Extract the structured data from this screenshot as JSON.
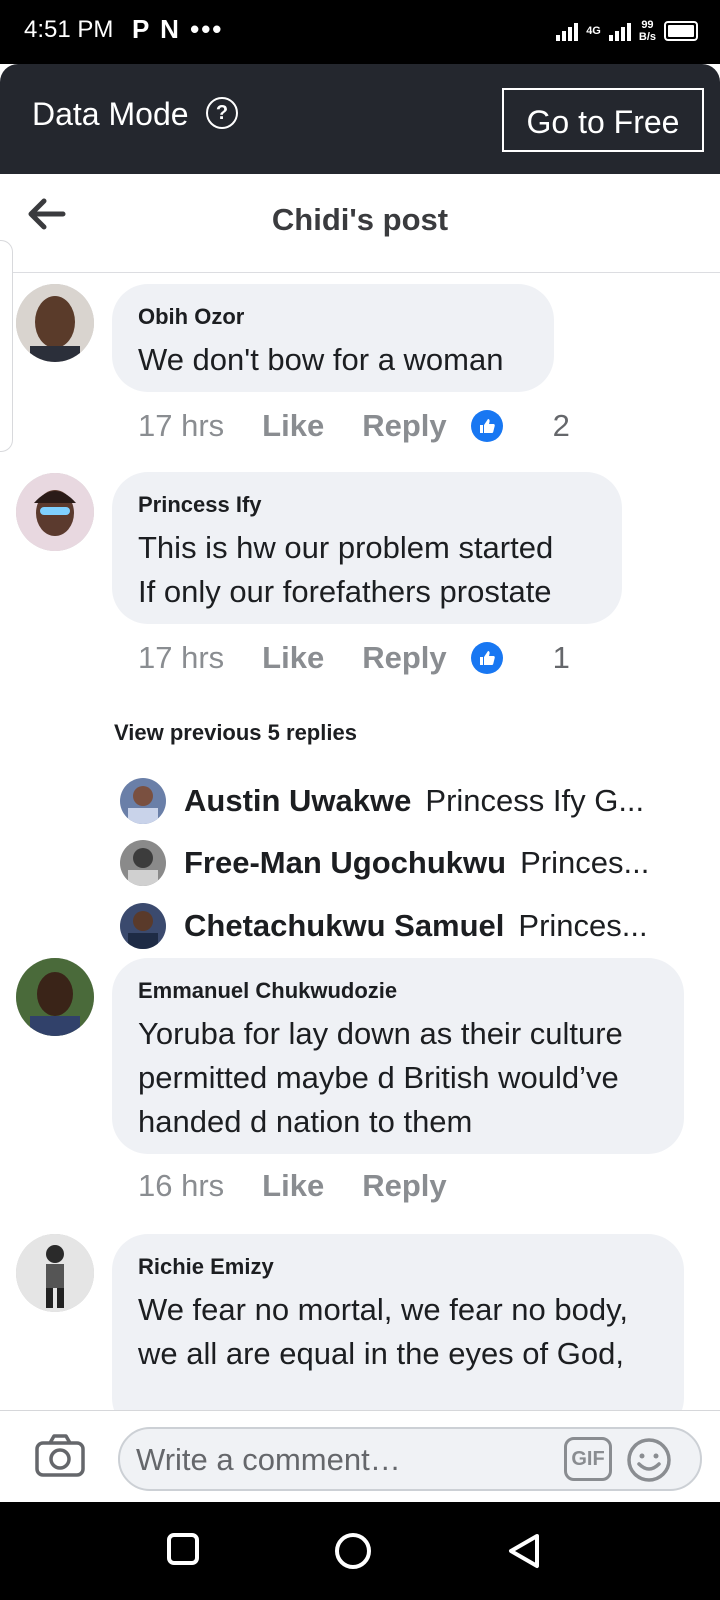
{
  "status_bar": {
    "time": "4:51 PM",
    "app_icons": "P N •••",
    "network": "4G",
    "speed_value": "99",
    "speed_unit": "B/s"
  },
  "data_mode": {
    "label": "Data Mode",
    "help_icon": "question-circle-icon",
    "button": "Go to Free"
  },
  "header": {
    "back_icon": "arrow-left-icon",
    "title": "Chidi's post"
  },
  "comments": [
    {
      "author": "Obih Ozor",
      "lines": [
        "We don't bow for a woman"
      ],
      "time": "17 hrs",
      "like": "Like",
      "reply": "Reply",
      "reactions": "2"
    },
    {
      "author": "Princess Ify",
      "lines": [
        "This is hw our problem started",
        "If only our forefathers prostate"
      ],
      "time": "17 hrs",
      "like": "Like",
      "reply": "Reply",
      "reactions": "1"
    },
    {
      "author": "Emmanuel Chukwudozie",
      "lines": [
        "Yoruba for lay down as their culture",
        "permitted maybe d British would’ve",
        "handed d nation to them"
      ],
      "time": "16 hrs",
      "like": "Like",
      "reply": "Reply"
    },
    {
      "author": "Richie Emizy",
      "lines": [
        "We fear no mortal, we fear no body,",
        "we all are equal in the eyes of God,"
      ]
    }
  ],
  "replies": {
    "view_previous": "View previous 5 replies",
    "items": [
      {
        "name": "Austin Uwakwe",
        "text": "Princess Ify G..."
      },
      {
        "name": "Free-Man Ugochukwu",
        "text": "Princes..."
      },
      {
        "name": "Chetachukwu Samuel",
        "text": "Princes..."
      }
    ]
  },
  "composer": {
    "placeholder": "Write a comment…",
    "gif": "GIF",
    "camera_icon": "camera-icon",
    "emoji_icon": "smiley-icon"
  },
  "nav": {
    "recents_icon": "square-icon",
    "home_icon": "circle-icon",
    "back_icon": "triangle-back-icon"
  },
  "colors": {
    "like_blue": "#1877f2",
    "dark_bar": "#24272e",
    "bubble": "#eff1f5"
  }
}
